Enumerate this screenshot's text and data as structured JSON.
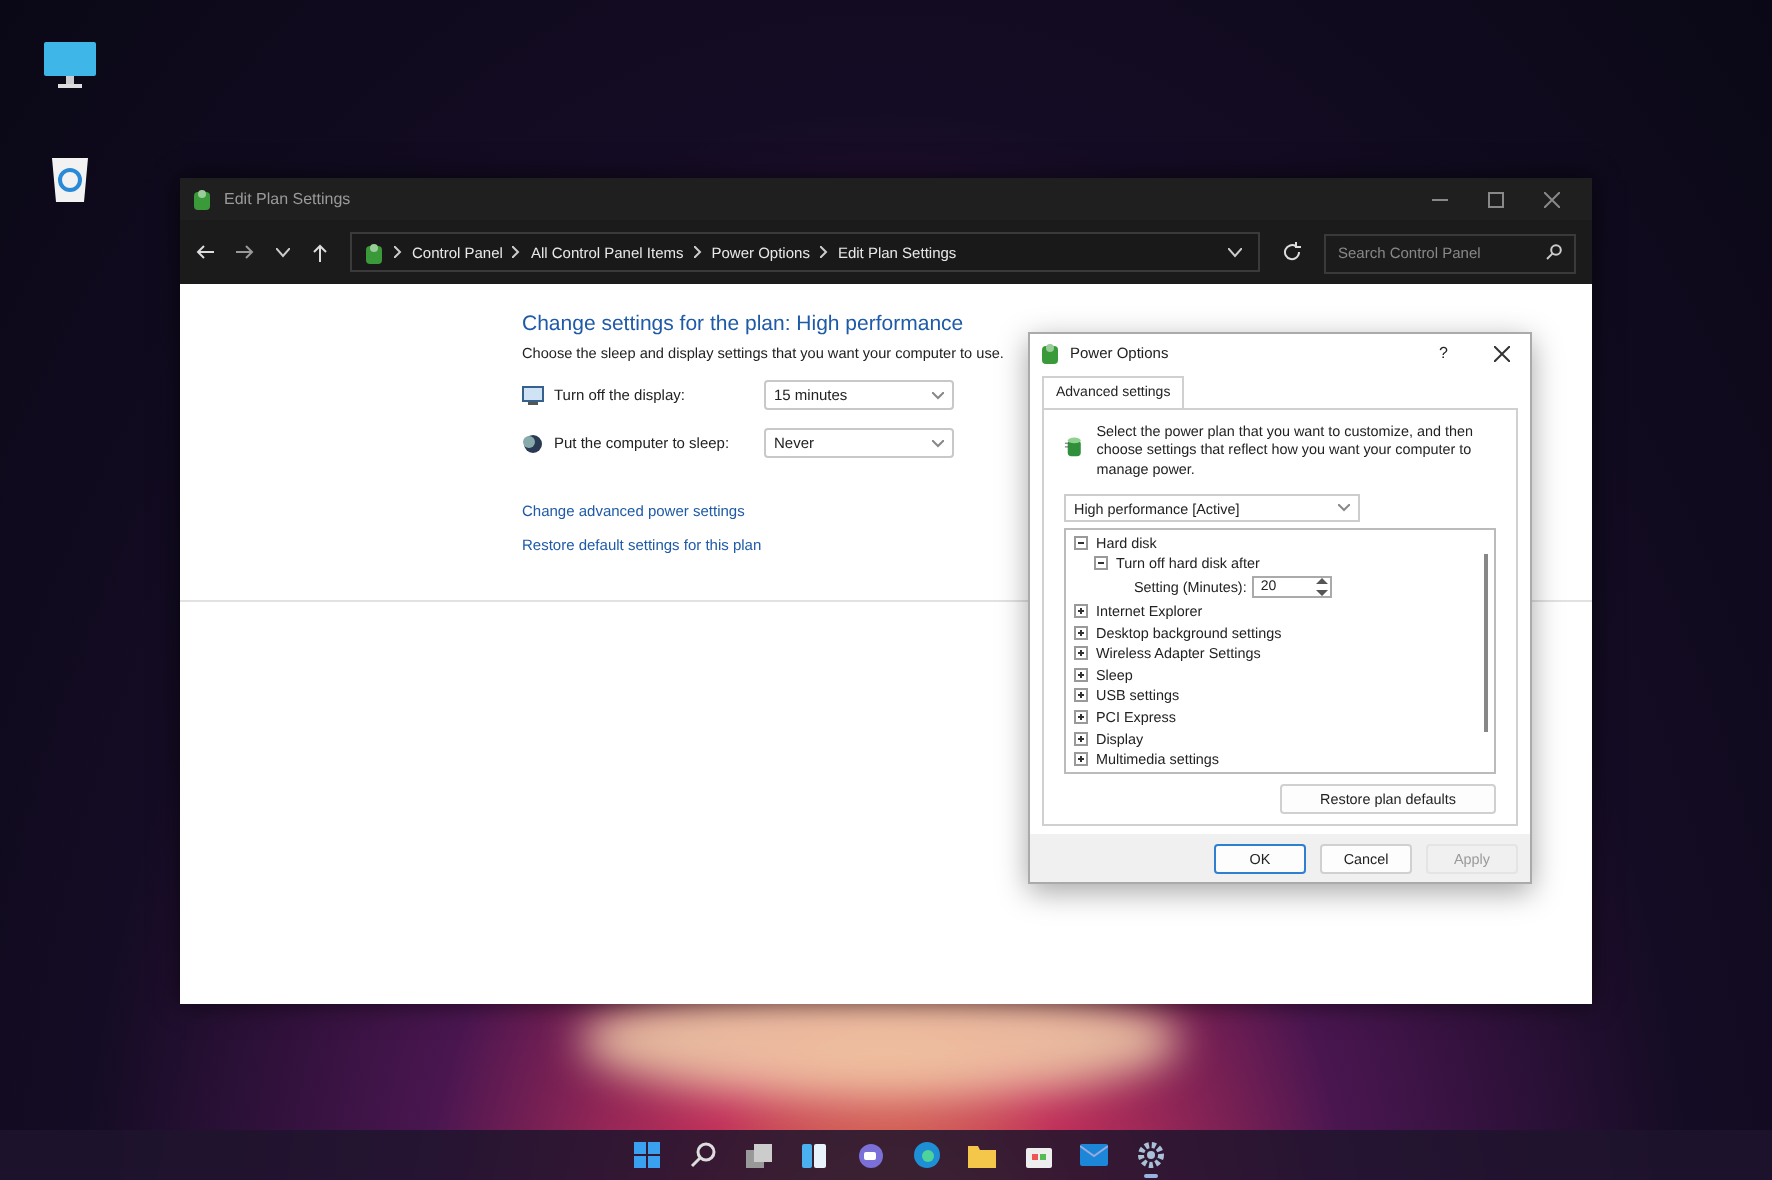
{
  "desktop_icons": [
    {
      "kind": "monitor"
    },
    {
      "kind": "recycle"
    }
  ],
  "window": {
    "title": "Edit Plan Settings",
    "breadcrumb": [
      "Control Panel",
      "All Control Panel Items",
      "Power Options",
      "Edit Plan Settings"
    ],
    "search": {
      "placeholder": "Search Control Panel"
    },
    "heading": "Change settings for the plan: High performance",
    "description": "Choose the sleep and display settings that you want your computer to use.",
    "settings": [
      {
        "kind": "display",
        "label": "Turn off the display:",
        "value": "15 minutes"
      },
      {
        "kind": "sleep",
        "label": "Put the computer to sleep:",
        "value": "Never"
      }
    ],
    "links": [
      "Change advanced power settings",
      "Restore default settings for this plan"
    ]
  },
  "dialog": {
    "title": "Power Options",
    "help": "?",
    "tabs": [
      {
        "label": "Advanced settings",
        "selected": true
      }
    ],
    "intro": "Select the power plan that you want to customize, and then choose settings that reflect how you want your computer to manage power.",
    "plan": "High performance [Active]",
    "tree": [
      {
        "label": "Hard disk",
        "expanded": true,
        "children": [
          {
            "label": "Turn off hard disk after",
            "expanded": true,
            "setting": {
              "label": "Setting (Minutes):",
              "value": "20"
            }
          }
        ]
      },
      {
        "label": "Internet Explorer",
        "expanded": false
      },
      {
        "label": "Desktop background settings",
        "expanded": false
      },
      {
        "label": "Wireless Adapter Settings",
        "expanded": false
      },
      {
        "label": "Sleep",
        "expanded": false
      },
      {
        "label": "USB settings",
        "expanded": false
      },
      {
        "label": "PCI Express",
        "expanded": false
      },
      {
        "label": "Display",
        "expanded": false
      },
      {
        "label": "Multimedia settings",
        "expanded": false
      }
    ],
    "restore_button": "Restore plan defaults",
    "buttons": [
      {
        "label": "OK",
        "disabled": false,
        "default": true
      },
      {
        "label": "Cancel",
        "disabled": false,
        "default": false
      },
      {
        "label": "Apply",
        "disabled": true,
        "default": false
      }
    ]
  },
  "taskbar": [
    {
      "kind": "start",
      "selected": false
    },
    {
      "kind": "search",
      "selected": false
    },
    {
      "kind": "taskview",
      "selected": false
    },
    {
      "kind": "widgets",
      "selected": false
    },
    {
      "kind": "chat",
      "selected": false
    },
    {
      "kind": "browser",
      "selected": false
    },
    {
      "kind": "folder",
      "selected": false
    },
    {
      "kind": "store",
      "selected": false
    },
    {
      "kind": "mail",
      "selected": false
    },
    {
      "kind": "settings",
      "selected": true
    }
  ]
}
